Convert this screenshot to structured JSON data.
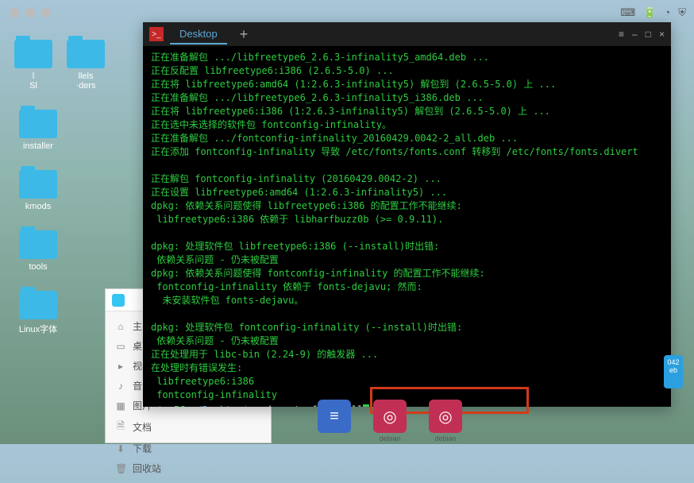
{
  "titlebar": {
    "blurred_title": ""
  },
  "menubar_icons": [
    "keyboard-icon",
    "battery-icon",
    "clock-icon",
    "shield-icon"
  ],
  "desktop_icons": [
    {
      "label_a": "l",
      "label_b": "llels"
    },
    {
      "label_a": "Sl",
      "label_b": "·ders"
    },
    {
      "label": "installer"
    },
    {
      "label": "kmods"
    },
    {
      "label": "tools"
    },
    {
      "label": "Linux字体"
    }
  ],
  "file_manager": {
    "sidebar": [
      {
        "icon": "⌂",
        "label": "主目录"
      },
      {
        "icon": "▭",
        "label": "桌面"
      },
      {
        "icon": "▸",
        "label": "视频"
      },
      {
        "icon": "♪",
        "label": "音乐"
      },
      {
        "icon": "▦",
        "label": "图片"
      },
      {
        "icon": "🗎",
        "label": "文档"
      },
      {
        "icon": "⬇",
        "label": "下载"
      },
      {
        "icon": "🗑",
        "label": "回收站"
      }
    ]
  },
  "terminal": {
    "tab_label": "Desktop",
    "window_buttons": {
      "menu": "≡",
      "min": "–",
      "max": "□",
      "close": "×"
    },
    "lines": [
      "正在准备解包 .../libfreetype6_2.6.3-infinality5_amd64.deb ...",
      "正在反配置 libfreetype6:i386 (2.6.5-5.0) ...",
      "正在将 libfreetype6:amd64 (1:2.6.3-infinality5) 解包到 (2.6.5-5.0) 上 ...",
      "正在准备解包 .../libfreetype6_2.6.3-infinality5_i386.deb ...",
      "正在将 libfreetype6:i386 (1:2.6.3-infinality5) 解包到 (2.6.5-5.0) 上 ...",
      "正在选中未选择的软件包 fontconfig-infinality。",
      "正在准备解包 .../fontconfig-infinality_20160429.0042-2_all.deb ...",
      "正在添加 fontconfig-infinality 导致 /etc/fonts/fonts.conf 转移到 /etc/fonts/fonts.divert",
      " ",
      "正在解包 fontconfig-infinality (20160429.0042-2) ...",
      "正在设置 libfreetype6:amd64 (1:2.6.3-infinality5) ...",
      "dpkg: 依赖关系问题使得 libfreetype6:i386 的配置工作不能继续:",
      " libfreetype6:i386 依赖于 libharfbuzz0b (>= 0.9.11).",
      " ",
      "dpkg: 处理软件包 libfreetype6:i386 (--install)时出错:",
      " 依赖关系问题 - 仍未被配置",
      "dpkg: 依赖关系问题使得 fontconfig-infinality 的配置工作不能继续:",
      " fontconfig-infinality 依赖于 fonts-dejavu; 然而:",
      "  未安装软件包 fonts-dejavu。",
      " ",
      "dpkg: 处理软件包 fontconfig-infinality (--install)时出错:",
      " 依赖关系问题 - 仍未被配置",
      "正在处理用于 libc-bin (2.24-9) 的触发器 ...",
      "在处理时有错误发生:",
      " libfreetype6:i386",
      " fontconfig-infinality"
    ],
    "prompt": {
      "user": "a@a-PC",
      "path": "~/Desktop",
      "sep": "$",
      "command": "sudo apt -f install"
    }
  },
  "dock": [
    {
      "label": "",
      "color": "#3a6bc7",
      "glyph": "≡"
    },
    {
      "label": "debian",
      "color": "#c13054",
      "glyph": "◎"
    },
    {
      "label": "debian",
      "color": "#c13054",
      "glyph": "◎"
    }
  ],
  "side_tile": {
    "label_top": "042",
    "label_bot": "eb"
  }
}
